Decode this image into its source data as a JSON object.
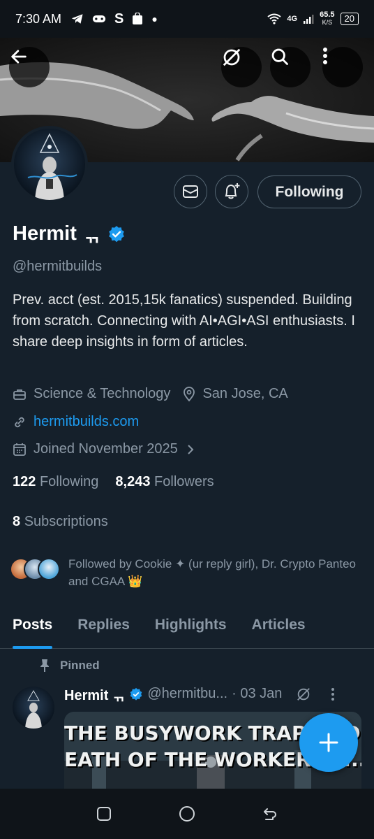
{
  "status_bar": {
    "time": "7:30 AM",
    "network": "4G",
    "speed_value": "65.5",
    "speed_unit": "K/S",
    "battery": "20"
  },
  "profile": {
    "display_name": "Hermit",
    "name_glyph": "ᆩ",
    "handle": "@hermitbuilds",
    "bio": "Prev. acct (est. 2015,15k fanatics) suspended. Building from scratch. Connecting with AI•AGI•ASI enthusiasts. I share deep insights in form of articles.",
    "category": "Science & Technology",
    "location": "San Jose, CA",
    "website": "hermitbuilds.com",
    "joined": "Joined November 2025",
    "following_count": "122",
    "following_label": "Following",
    "followers_count": "8,243",
    "followers_label": "Followers",
    "subscriptions_count": "8",
    "subscriptions_label": "Subscriptions",
    "followed_by": "Followed by Cookie ✦ (ur reply girl), Dr. Crypto Panteo and CGAA 👑",
    "follow_button": "Following"
  },
  "tabs": [
    {
      "label": "Posts",
      "active": true
    },
    {
      "label": "Replies",
      "active": false
    },
    {
      "label": "Highlights",
      "active": false
    },
    {
      "label": "Articles",
      "active": false
    }
  ],
  "pinned_post": {
    "pinned_label": "Pinned",
    "author": "Hermit ᆩ",
    "handle": "@hermitbu...",
    "date": "· 03 Jan",
    "image_line1": "THE BUSYWORK TRAP AND...",
    "image_line2": "EATH OF THE WORKER LE..."
  },
  "colors": {
    "background": "#15202b",
    "accent": "#1d9bf0",
    "muted": "#8b98a5"
  },
  "icons": [
    "back-arrow-icon",
    "grok-icon",
    "search-icon",
    "more-vertical-icon",
    "mail-icon",
    "bell-plus-icon",
    "briefcase-icon",
    "location-pin-icon",
    "link-icon",
    "calendar-icon",
    "chevron-right-icon",
    "pin-icon",
    "verified-badge-icon",
    "plus-icon",
    "recents-icon",
    "home-icon",
    "back-nav-icon"
  ]
}
